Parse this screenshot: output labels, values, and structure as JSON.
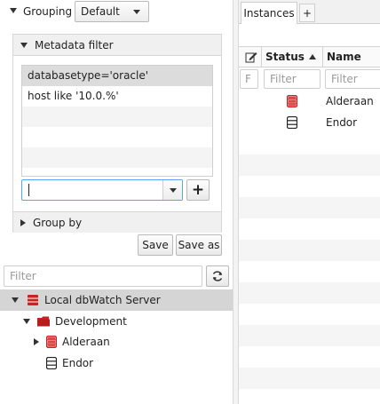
{
  "grouping": {
    "label": "Grouping",
    "selected": "Default"
  },
  "metadata_filter": {
    "title": "Metadata filter",
    "filters": [
      "databasetype='oracle'",
      "host like '10.0.%'"
    ],
    "input_value": "",
    "add_label": "+"
  },
  "group_by": {
    "title": "Group by"
  },
  "buttons": {
    "save": "Save",
    "save_as": "Save as"
  },
  "tree": {
    "filter_placeholder": "Filter",
    "items": [
      {
        "label": "Local dbWatch Server",
        "icon": "server-stack-icon",
        "color": "#cc2222"
      },
      {
        "label": "Development",
        "icon": "folder-icon",
        "color": "#cc2222"
      },
      {
        "label": "Alderaan",
        "icon": "database-icon",
        "color": "#cc2222"
      },
      {
        "label": "Endor",
        "icon": "database-icon",
        "color": "#222222"
      }
    ]
  },
  "tabs": {
    "instances": "Instances",
    "add": "+"
  },
  "grid": {
    "columns": {
      "status": "Status",
      "name": "Name"
    },
    "first_filter": "F",
    "status_filter_placeholder": "Filter",
    "name_filter_placeholder": "Filter",
    "rows": [
      {
        "name": "Alderaan",
        "status_color": "#cc2222"
      },
      {
        "name": "Endor",
        "status_color": "#222222"
      }
    ]
  },
  "colors": {
    "accent_focus": "#5aa0ff",
    "selection": "#dcdcdc",
    "error": "#cc2222"
  }
}
